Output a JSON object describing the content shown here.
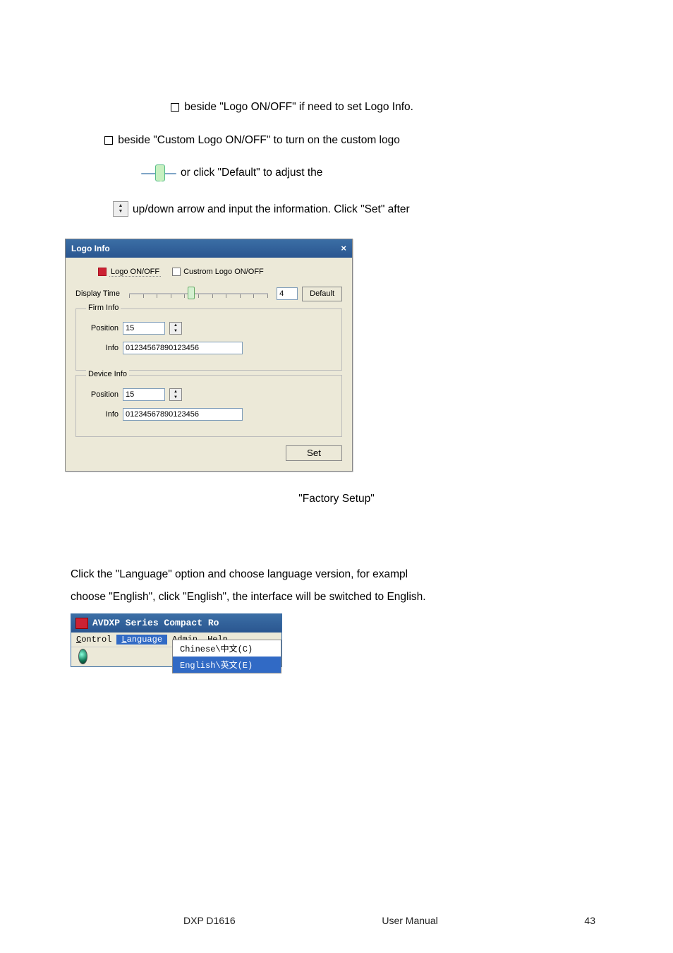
{
  "instr": {
    "line1": "  beside \"Logo ON/OFF\" if need to set Logo Info.",
    "line2": "  beside \"Custom Logo ON/OFF\" to turn on the custom logo",
    "line3": " or click \"Default\" to adjust the",
    "line4": " up/down arrow and input the information. Click \"Set\" after"
  },
  "dialog": {
    "title": "Logo Info",
    "logo_onoff": "Logo ON/OFF",
    "custom_logo": "Custrom Logo ON/OFF",
    "display_time_label": "Display Time",
    "display_time_value": "4",
    "default_btn": "Default",
    "firm_info": {
      "legend": "Firm Info",
      "position_label": "Position",
      "position_value": "15",
      "info_label": "Info",
      "info_value": "01234567890123456"
    },
    "device_info": {
      "legend": "Device Info",
      "position_label": "Position",
      "position_value": "15",
      "info_label": "Info",
      "info_value": "01234567890123456"
    },
    "set_btn": "Set"
  },
  "factory_label": "\"Factory Setup\"",
  "body": {
    "p1": "Click the \"Language\" option and choose language version, for exampl",
    "p2": "choose \"English\", click \"English\", the interface will be switched to English."
  },
  "menu": {
    "title": "AVDXP Series Compact Ro",
    "items": {
      "control": "Control",
      "language": "Language",
      "admin": "Admin",
      "help": "Help"
    },
    "dropdown": {
      "chinese": "Chinese\\中文(C)",
      "english": "English\\英文(E)"
    }
  },
  "footer": {
    "left": "DXP D1616",
    "center": "User Manual",
    "right": "43"
  }
}
